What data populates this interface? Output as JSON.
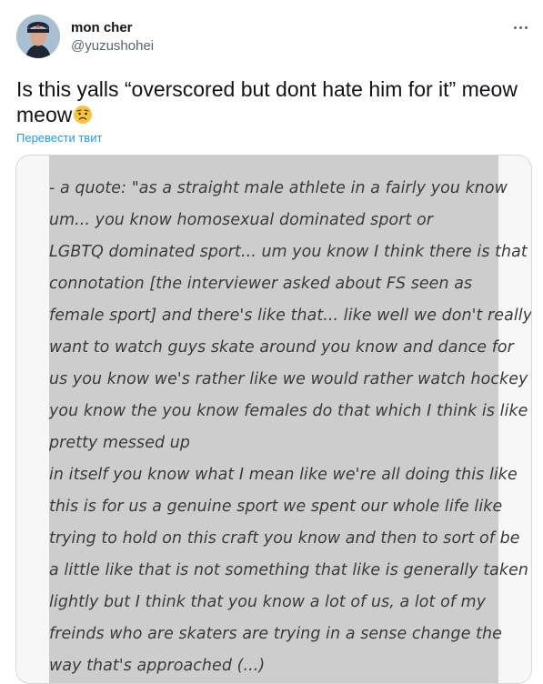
{
  "author": {
    "name": "mon cher",
    "handle": "@yuzushohei"
  },
  "tweet": {
    "text": "Is this yalls “overscored but dont hate him for it” meow meow",
    "emoji": "worried-face-emoji",
    "translate_label": "Перевести твит"
  },
  "media": {
    "lines": [
      "- a quote: \"as a straight male athlete in a fairly you know",
      "um... you know homosexual dominated sport or",
      "LGBTQ dominated sport... um you know I think there is that",
      "connotation [the interviewer asked about FS  seen as",
      "female sport]  and there's like that... like well we don't really",
      "want to watch guys skate around you know and dance for",
      "us you know we's rather like we would rather watch hockey",
      "you know the you know females do that which I think is like",
      "pretty messed up",
      "in itself you know what I mean like we're all doing this like",
      "this is for us a genuine sport we spent our whole life like",
      "trying to hold on this craft you know and then to sort of be",
      "a little like that is not something that like is generally taken",
      "lightly but I think that you know a lot of us, a lot of my",
      "freinds who are skaters are trying in a sense change the",
      "way that's approached  (...)"
    ]
  },
  "colors": {
    "link": "#1d9bf0",
    "secondary_text": "#536471",
    "media_bg": "#cdcdcd"
  }
}
